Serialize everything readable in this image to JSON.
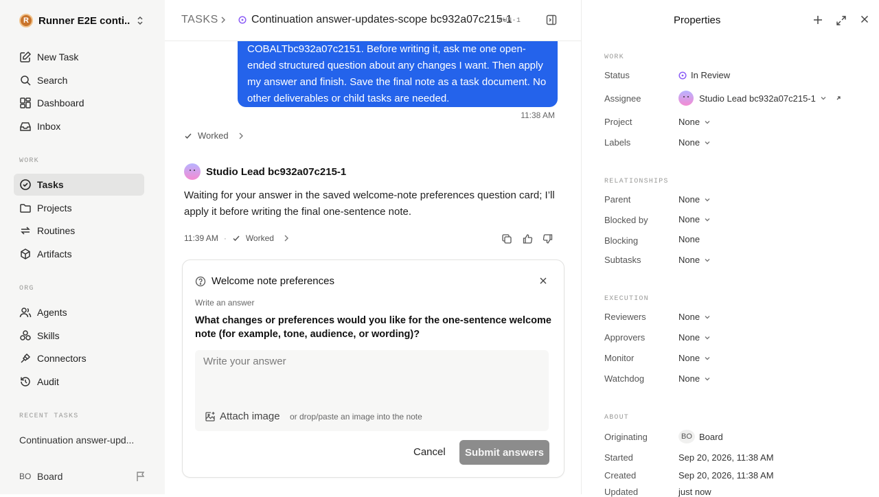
{
  "sidebar": {
    "workspace": {
      "logo": "R",
      "name": "Runner E2E conti..."
    },
    "nav_top": [
      {
        "label": "New Task",
        "icon": "new-task-icon"
      },
      {
        "label": "Search",
        "icon": "search-icon"
      },
      {
        "label": "Dashboard",
        "icon": "dashboard-icon"
      },
      {
        "label": "Inbox",
        "icon": "inbox-icon"
      }
    ],
    "work_label": "WORK",
    "nav_work": [
      {
        "label": "Tasks",
        "icon": "tasks-icon",
        "active": true
      },
      {
        "label": "Projects",
        "icon": "folder-icon"
      },
      {
        "label": "Routines",
        "icon": "routines-icon"
      },
      {
        "label": "Artifacts",
        "icon": "artifacts-icon"
      }
    ],
    "org_label": "ORG",
    "nav_org": [
      {
        "label": "Agents",
        "icon": "agents-icon"
      },
      {
        "label": "Skills",
        "icon": "skills-icon"
      },
      {
        "label": "Connectors",
        "icon": "connectors-icon"
      },
      {
        "label": "Audit",
        "icon": "audit-icon"
      }
    ],
    "recent_label": "RECENT TASKS",
    "recent": [
      "Continuation answer-upd..."
    ],
    "footer": {
      "initials": "BO",
      "name": "Board"
    }
  },
  "header": {
    "root": "TASKS",
    "title": "Continuation answer-updates-scope bc932a07c215-1",
    "run": "RUN-1"
  },
  "chat": {
    "user_message": "COBALTbc932a07c2151. Before writing it, ask me one open-ended structured question about any changes I want. Then apply my answer and finish. Save the final note as a task document. No other deliverables or child tasks are needed.",
    "user_time": "11:38 AM",
    "worked_label": "Worked",
    "agent_name": "Studio Lead bc932a07c215-1",
    "agent_message": "Waiting for your answer in the saved welcome-note preferences question card; I’ll apply it before writing the final one-sentence note.",
    "agent_time": "11:39 AM",
    "agent_dot": "·",
    "agent_worked": "Worked"
  },
  "question_card": {
    "title": "Welcome note preferences",
    "subtitle": "Write an answer",
    "question": "What changes or preferences would you like for the one-sentence welcome note (for example, tone, audience, or wording)?",
    "placeholder": "Write your answer",
    "attach_label": "Attach image",
    "attach_hint": "or drop/paste an image into the note",
    "cancel_label": "Cancel",
    "submit_label": "Submit answers"
  },
  "properties": {
    "title": "Properties",
    "work_label": "WORK",
    "status_key": "Status",
    "status_val": "In Review",
    "assignee_key": "Assignee",
    "assignee_val": "Studio Lead bc932a07c215-1",
    "project_key": "Project",
    "project_val": "None",
    "labels_key": "Labels",
    "labels_val": "None",
    "rel_label": "RELATIONSHIPS",
    "parent_key": "Parent",
    "parent_val": "None",
    "blockedby_key": "Blocked by",
    "blockedby_val": "None",
    "blocking_key": "Blocking",
    "blocking_val": "None",
    "subtasks_key": "Subtasks",
    "subtasks_val": "None",
    "exec_label": "EXECUTION",
    "reviewers_key": "Reviewers",
    "reviewers_val": "None",
    "approvers_key": "Approvers",
    "approvers_val": "None",
    "monitor_key": "Monitor",
    "monitor_val": "None",
    "watchdog_key": "Watchdog",
    "watchdog_val": "None",
    "about_label": "ABOUT",
    "originating_key": "Originating",
    "originating_initials": "BO",
    "originating_val": "Board",
    "started_key": "Started",
    "started_val": "Sep 20, 2026, 11:38 AM",
    "created_key": "Created",
    "created_val": "Sep 20, 2026, 11:38 AM",
    "updated_key": "Updated",
    "updated_val": "just now"
  },
  "colors": {
    "accent": "#2463eb",
    "status_in_review": "#8b5cf6",
    "sidebar_bg": "#f6f6f5"
  }
}
